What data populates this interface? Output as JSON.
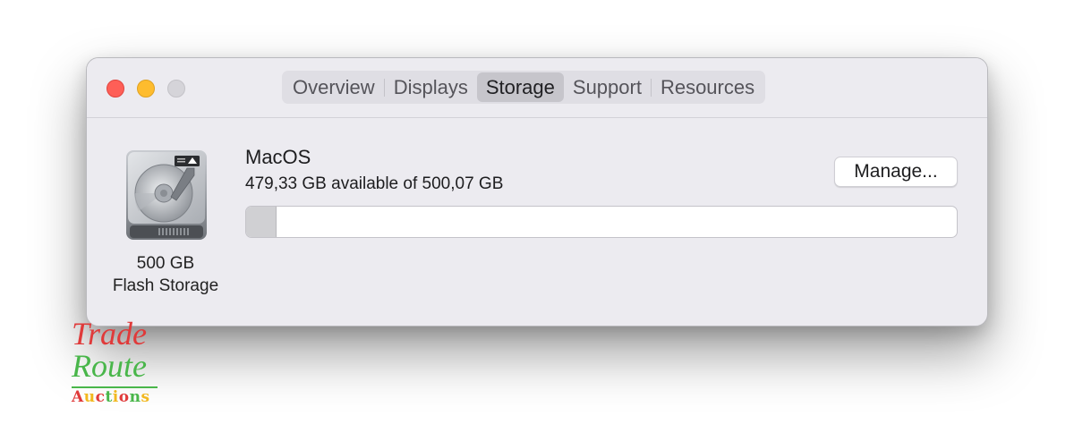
{
  "tabs": [
    {
      "label": "Overview",
      "active": false
    },
    {
      "label": "Displays",
      "active": false
    },
    {
      "label": "Storage",
      "active": true
    },
    {
      "label": "Support",
      "active": false
    },
    {
      "label": "Resources",
      "active": false
    }
  ],
  "disk": {
    "icon": "hard-drive-icon",
    "size_label": "500 GB",
    "kind_label": "Flash Storage"
  },
  "volume": {
    "name": "MacOS",
    "availability": "479,33 GB available of 500,07 GB",
    "used_fraction": 0.041
  },
  "buttons": {
    "manage": "Manage..."
  },
  "watermark": {
    "line1": "Trade",
    "line2": "Route",
    "line3": "Auctions",
    "colors": [
      "#e03a3a",
      "#49b64a",
      "#f2b81f"
    ]
  }
}
